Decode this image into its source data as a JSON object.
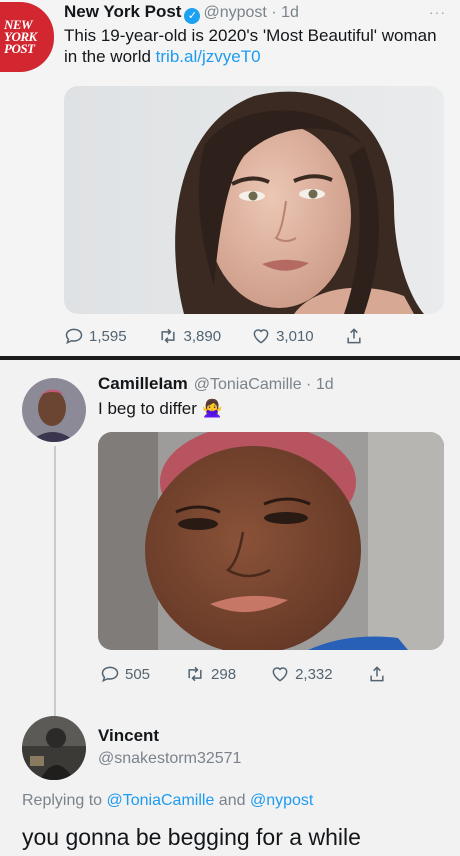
{
  "tweet1": {
    "avatar_text": [
      "NEW",
      "YORK",
      "POST"
    ],
    "name": "New York Post",
    "handle": "@nypost",
    "time": "1d",
    "text": "This 19-year-old is 2020's 'Most Beautiful' woman in the world",
    "link": "trib.al/jzvyeT0",
    "replies": "1,595",
    "retweets": "3,890",
    "likes": "3,010",
    "more_icon": "ellipsis-icon"
  },
  "tweet2": {
    "name": "CamilleIam",
    "handle": "@ToniaCamille",
    "time": "1d",
    "text": "I beg to differ",
    "emoji": "🙅‍♀️",
    "replies": "505",
    "retweets": "298",
    "likes": "2,332"
  },
  "tweet3": {
    "name": "Vincent",
    "handle": "@snakestorm32571",
    "replying_prefix": "Replying to",
    "replying_user1": "@ToniaCamille",
    "replying_and": "and",
    "replying_user2": "@nypost",
    "text": "you gonna be begging for a while"
  },
  "colors": {
    "link_blue": "#1d9bf0",
    "nypost_red": "#d22630",
    "text_gray": "#536471"
  }
}
